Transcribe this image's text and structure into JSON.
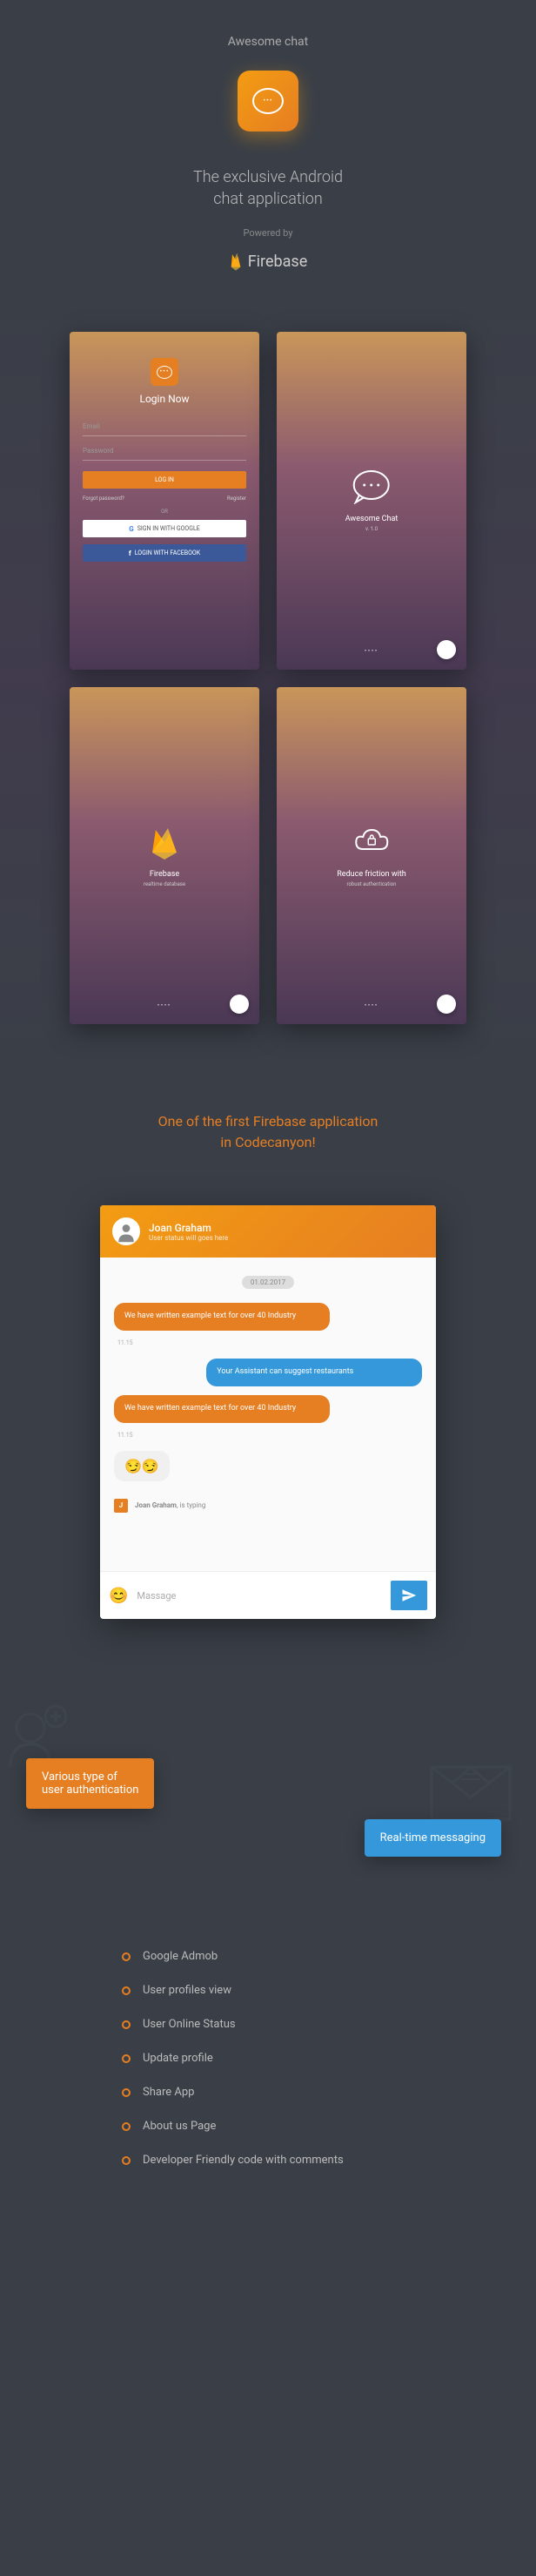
{
  "app_title": "Awesome chat",
  "subtitle": "The exclusive Android\nchat application",
  "powered_by": "Powered by",
  "firebase": "Firebase",
  "login_screen": {
    "title": "Login Now",
    "email_placeholder": "Email",
    "password_placeholder": "Password",
    "login_btn": "LOG IN",
    "forgot": "Forgot password?",
    "register": "Register",
    "or": "OR",
    "google_btn": "SIGN IN WITH GOOGLE",
    "facebook_btn": "LOGIN WITH FACEBOOK"
  },
  "splash_screen": {
    "title": "Awesome Chat",
    "subtitle": "v. 1.0"
  },
  "firebase_screen": {
    "title": "Firebase",
    "subtitle": "realtime database"
  },
  "auth_screen": {
    "title": "Reduce friction with",
    "subtitle": "robust authentication"
  },
  "tagline": "One of the first Firebase application\nin Codecanyon!",
  "chat": {
    "name": "Joan Graham",
    "status": "User status will goes here",
    "date": "01.02.2017",
    "msg1": "We have written example text for over 40 Industry",
    "time1": "11.15",
    "msg2": "Your Assistant can suggest restaurants",
    "msg3": "We have written example text for over 40 Industry",
    "time3": "11.15",
    "emoji": "😏😏",
    "typing_name": "Joan Graham",
    "typing_text": "is typing",
    "typing_initial": "J",
    "input_placeholder": "Massage"
  },
  "badges": {
    "auth": "Various type of\nuser authentication",
    "realtime": "Real-time messaging"
  },
  "features": [
    "Google Admob",
    "User profiles view",
    "User Online Status",
    "Update profile",
    "Share App",
    "About us Page",
    "Developer Friendly code with comments"
  ]
}
